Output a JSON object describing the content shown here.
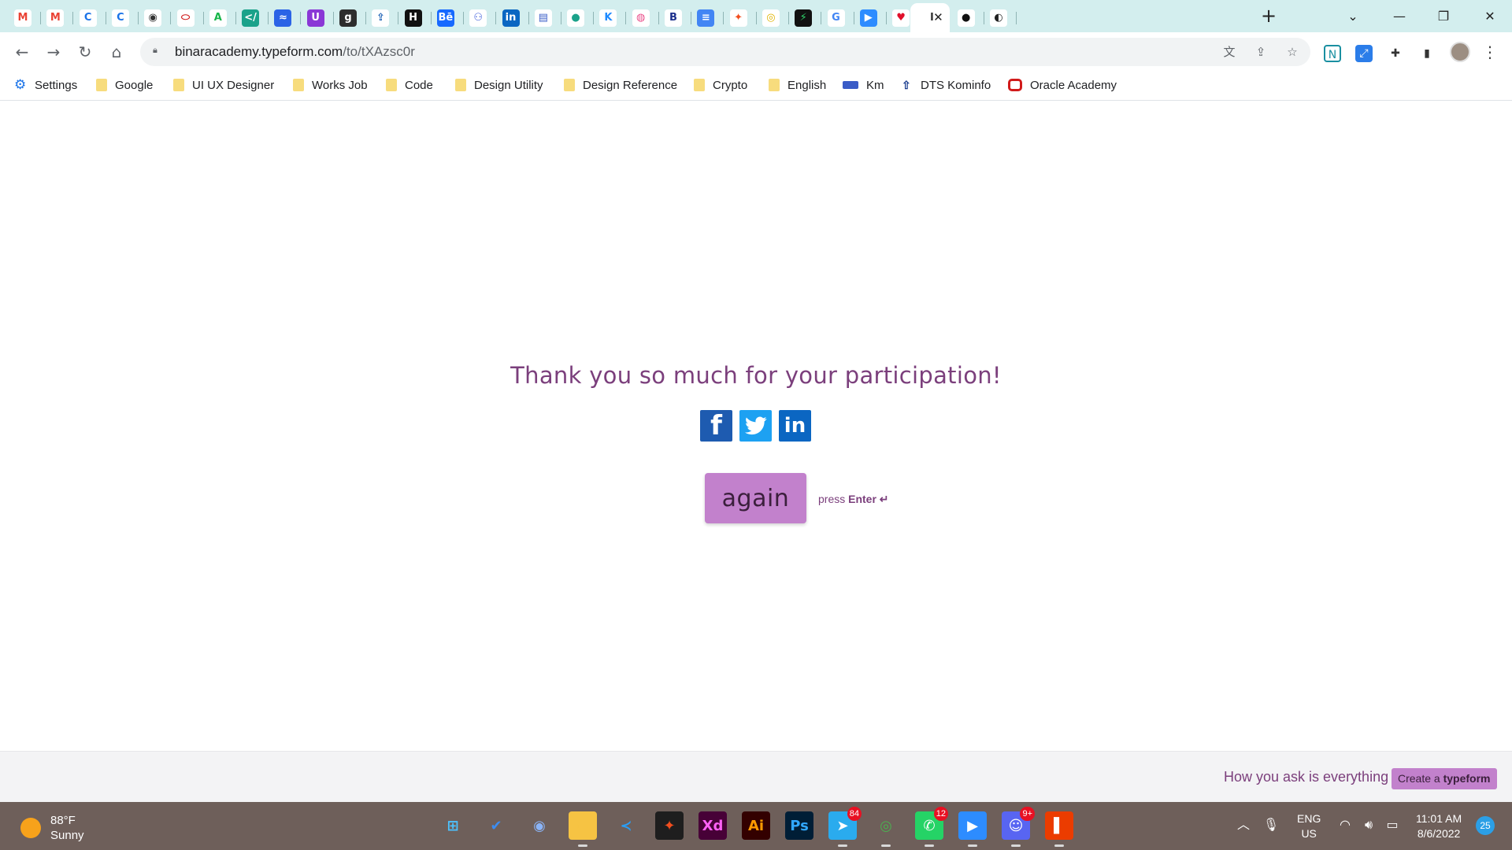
{
  "browser": {
    "tabs": [
      {
        "icon": "gmail-icon",
        "glyph": "M",
        "color": "#ea4335",
        "bg": "#ffffff"
      },
      {
        "icon": "gmail-icon",
        "glyph": "M",
        "color": "#ea4335",
        "bg": "#ffffff"
      },
      {
        "icon": "google-c-icon",
        "glyph": "C",
        "color": "#1a73e8",
        "bg": "#ffffff"
      },
      {
        "icon": "google-c-icon",
        "glyph": "C",
        "color": "#1a73e8",
        "bg": "#ffffff"
      },
      {
        "icon": "github-alt-icon",
        "glyph": "◉",
        "color": "#333333",
        "bg": "#ffffff"
      },
      {
        "icon": "oracle-icon",
        "glyph": "⬭",
        "color": "#d11a1a",
        "bg": "#ffffff"
      },
      {
        "icon": "a-logo-icon",
        "glyph": "A",
        "color": "#18b64a",
        "bg": "#ffffff"
      },
      {
        "icon": "code-icon",
        "glyph": "</",
        "color": "#ffffff",
        "bg": "#1aa28a"
      },
      {
        "icon": "wave-icon",
        "glyph": "≈",
        "color": "#ffffff",
        "bg": "#2b63e6"
      },
      {
        "icon": "purple-u-icon",
        "glyph": "U",
        "color": "#ffffff",
        "bg": "#8a37d6"
      },
      {
        "icon": "g-square-icon",
        "glyph": "g",
        "color": "#ffffff",
        "bg": "#2d2d2d"
      },
      {
        "icon": "upload-icon",
        "glyph": "⇪",
        "color": "#1a5fb4",
        "bg": "#ffffff"
      },
      {
        "icon": "hackernoon-icon",
        "glyph": "H",
        "color": "#ffffff",
        "bg": "#111111"
      },
      {
        "icon": "behance-icon",
        "glyph": "Bē",
        "color": "#ffffff",
        "bg": "#1769ff"
      },
      {
        "icon": "people-icon",
        "glyph": "⚇",
        "color": "#3b5bdb",
        "bg": "#ffffff"
      },
      {
        "icon": "linkedin-icon",
        "glyph": "in",
        "color": "#ffffff",
        "bg": "#0a66c2"
      },
      {
        "icon": "flag-icon",
        "glyph": "▤",
        "color": "#3a5cc7",
        "bg": "#ffffff"
      },
      {
        "icon": "chat-bubble-icon",
        "glyph": "●",
        "color": "#1aa28a",
        "bg": "#ffffff"
      },
      {
        "icon": "k-logo-icon",
        "glyph": "K",
        "color": "#1f8bff",
        "bg": "#ffffff"
      },
      {
        "icon": "dribbble-icon",
        "glyph": "◍",
        "color": "#ea4c89",
        "bg": "#ffffff"
      },
      {
        "icon": "b-logo-icon",
        "glyph": "B",
        "color": "#1c2f8c",
        "bg": "#ffffff"
      },
      {
        "icon": "google-docs-icon",
        "glyph": "≡",
        "color": "#ffffff",
        "bg": "#4285f4"
      },
      {
        "icon": "figma-icon",
        "glyph": "✦",
        "color": "#f24e1e",
        "bg": "#ffffff"
      },
      {
        "icon": "yellow-circle-icon",
        "glyph": "◎",
        "color": "#e0b400",
        "bg": "#ffffff"
      },
      {
        "icon": "bolt-icon",
        "glyph": "⚡",
        "color": "#2fd46b",
        "bg": "#111111"
      },
      {
        "icon": "google-icon",
        "glyph": "G",
        "color": "#4285f4",
        "bg": "#ffffff"
      },
      {
        "icon": "zoom-icon",
        "glyph": "▶",
        "color": "#ffffff",
        "bg": "#2d8cff"
      },
      {
        "icon": "heart-icon",
        "glyph": "♥",
        "color": "#e0102a",
        "bg": "#ffffff"
      },
      {
        "icon": "typeform-icon",
        "glyph": "I",
        "color": "#333333",
        "bg": "#ffffff"
      },
      {
        "icon": "black-circle-icon",
        "glyph": "●",
        "color": "#111111",
        "bg": "#ffffff"
      },
      {
        "icon": "github-icon",
        "glyph": "◐",
        "color": "#222222",
        "bg": "#ffffff"
      }
    ],
    "new_tab": "+",
    "address": {
      "host": "binaracademy.typeform.com",
      "path": "/to/tXAzsc0r"
    }
  },
  "bookmarks": [
    {
      "label": "Settings",
      "icon": "gear-icon",
      "type": "gear"
    },
    {
      "label": "Google",
      "icon": "folder-icon",
      "type": "folder"
    },
    {
      "label": "UI UX Designer",
      "icon": "folder-icon",
      "type": "folder"
    },
    {
      "label": "Works Job",
      "icon": "folder-icon",
      "type": "folder"
    },
    {
      "label": "Code",
      "icon": "folder-icon",
      "type": "folder"
    },
    {
      "label": "Design Utility",
      "icon": "folder-icon",
      "type": "folder"
    },
    {
      "label": "Design Reference",
      "icon": "folder-icon",
      "type": "folder"
    },
    {
      "label": "Crypto",
      "icon": "folder-icon",
      "type": "folder"
    },
    {
      "label": "English",
      "icon": "folder-icon",
      "type": "folder"
    },
    {
      "label": "Km",
      "icon": "km-icon",
      "type": "km"
    },
    {
      "label": "DTS Kominfo",
      "icon": "dts-icon",
      "type": "dts"
    },
    {
      "label": "Oracle Academy",
      "icon": "oracle-icon",
      "type": "oracle"
    }
  ],
  "page": {
    "message": "Thank you so much for your participation!",
    "again_label": "again",
    "press_prefix": "press",
    "press_key": "Enter ↵",
    "share": {
      "facebook": "f",
      "linkedin": "in"
    },
    "footer": {
      "tagline": "How you ask is everything",
      "create_prefix": "Create a",
      "create_brand": "typeform"
    },
    "colors": {
      "accent": "#7b3f7c",
      "button": "#c281cc"
    }
  },
  "taskbar": {
    "weather": {
      "temp": "88°F",
      "condition": "Sunny"
    },
    "apps": [
      {
        "name": "windows-start-icon",
        "glyph": "⊞",
        "bg": "transparent",
        "color": "#4cc2ff"
      },
      {
        "name": "todo-icon",
        "glyph": "✔",
        "bg": "transparent",
        "color": "#3c8cf0"
      },
      {
        "name": "camera-icon",
        "glyph": "◉",
        "bg": "transparent",
        "color": "#8ab4f8"
      },
      {
        "name": "file-explorer-icon",
        "glyph": "▭",
        "bg": "#f6c343",
        "color": "#f6c343"
      },
      {
        "name": "vscode-icon",
        "glyph": "≺",
        "bg": "transparent",
        "color": "#2a9df4"
      },
      {
        "name": "figma-icon",
        "glyph": "✦",
        "bg": "#1e1e1e",
        "color": "#f24e1e"
      },
      {
        "name": "adobe-xd-icon",
        "glyph": "Xd",
        "bg": "#470137",
        "color": "#ff61f6"
      },
      {
        "name": "illustrator-icon",
        "glyph": "Ai",
        "bg": "#330000",
        "color": "#ff9a00"
      },
      {
        "name": "photoshop-icon",
        "glyph": "Ps",
        "bg": "#001e36",
        "color": "#31a8ff"
      },
      {
        "name": "telegram-icon",
        "glyph": "➤",
        "bg": "#2aabee",
        "color": "#ffffff",
        "badge": "84"
      },
      {
        "name": "chrome-icon",
        "glyph": "◎",
        "bg": "transparent",
        "color": "#4caf50"
      },
      {
        "name": "whatsapp-icon",
        "glyph": "✆",
        "bg": "#25d366",
        "color": "#ffffff",
        "badge": "12"
      },
      {
        "name": "zoom-icon",
        "glyph": "▶",
        "bg": "#2d8cff",
        "color": "#ffffff"
      },
      {
        "name": "discord-icon",
        "glyph": "☺",
        "bg": "#5865f2",
        "color": "#ffffff",
        "badge": "9+"
      },
      {
        "name": "office-icon",
        "glyph": "▌",
        "bg": "#eb3c00",
        "color": "#ffffff"
      }
    ],
    "language": {
      "line1": "ENG",
      "line2": "US"
    },
    "time": "11:01 AM",
    "date": "8/6/2022",
    "notifications": "25"
  }
}
